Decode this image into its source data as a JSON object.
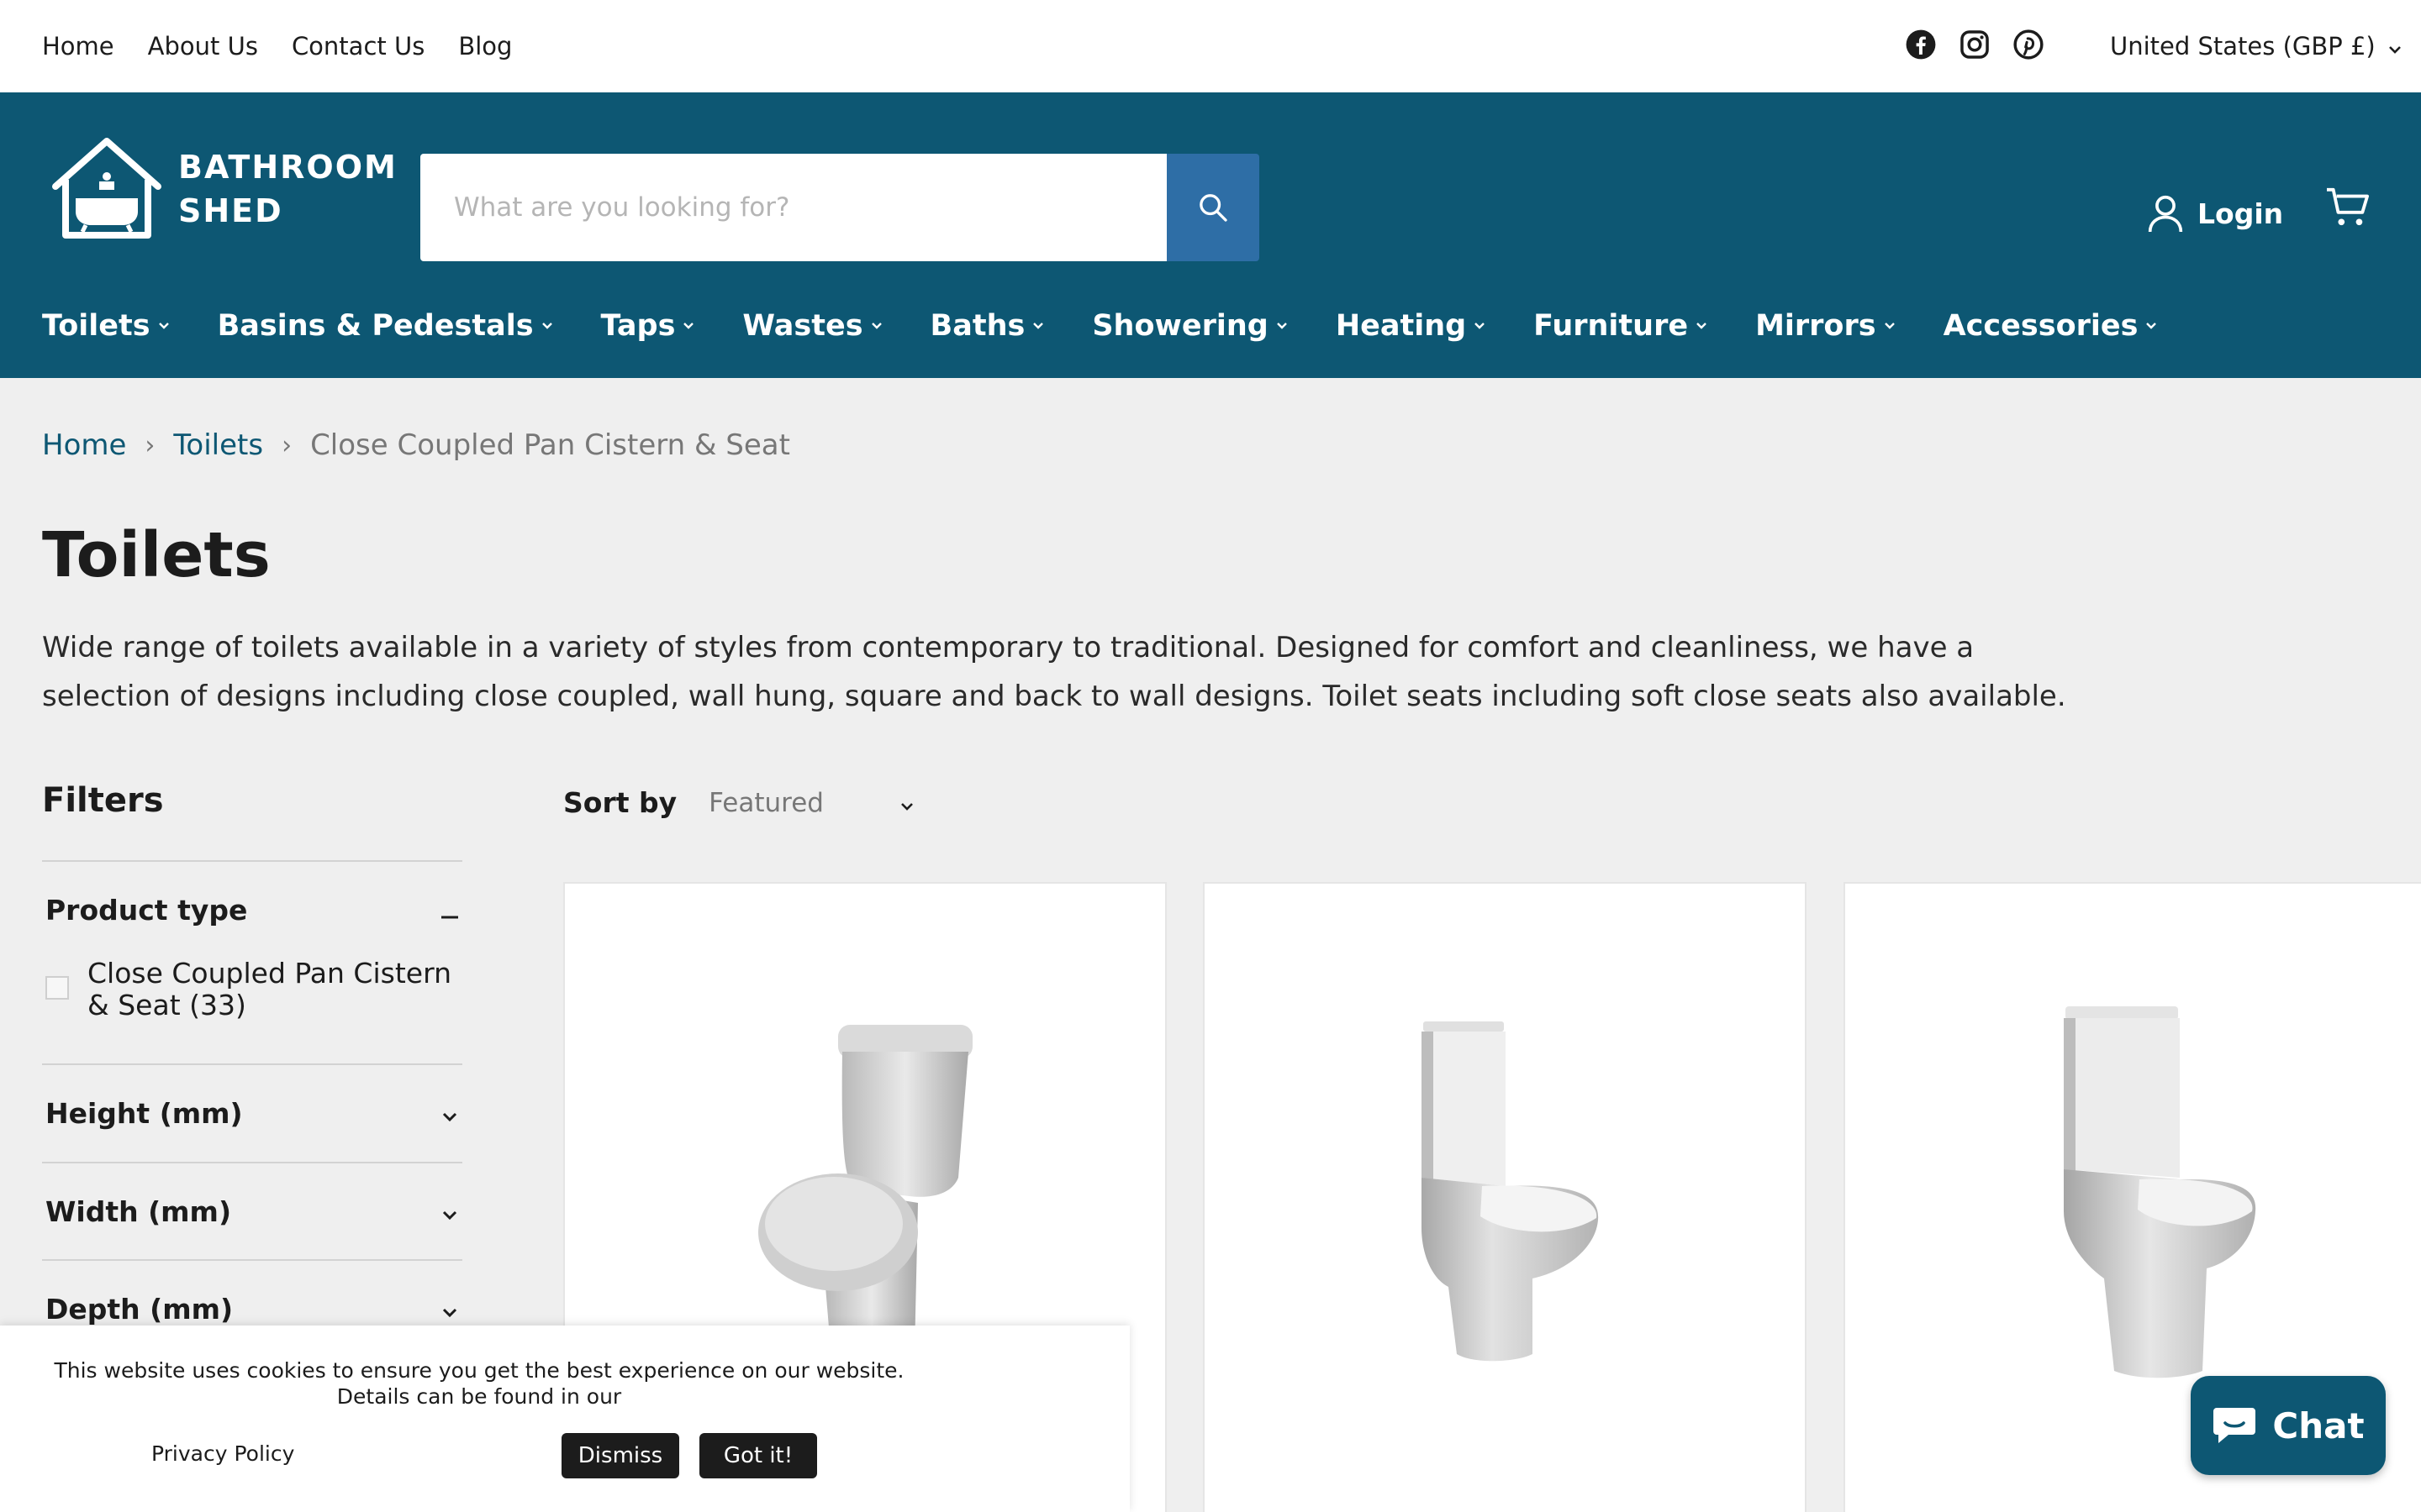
{
  "utility": {
    "links": [
      "Home",
      "About Us",
      "Contact Us",
      "Blog"
    ],
    "social_icons": [
      "facebook-icon",
      "instagram-icon",
      "pinterest-icon"
    ],
    "currency": "United States (GBP £)"
  },
  "header": {
    "logo_line1": "BATHROOM",
    "logo_line2": "SHED",
    "search_placeholder": "What are you looking for?",
    "login_label": "Login",
    "nav": [
      "Toilets",
      "Basins & Pedestals",
      "Taps",
      "Wastes",
      "Baths",
      "Showering",
      "Heating",
      "Furniture",
      "Mirrors",
      "Accessories"
    ]
  },
  "breadcrumb": {
    "home": "Home",
    "parent": "Toilets",
    "current": "Close Coupled Pan Cistern & Seat"
  },
  "page": {
    "title": "Toilets",
    "description": "Wide range of toilets available in a variety of styles from contemporary to traditional. Designed for comfort and cleanliness, we have a selection of designs including close coupled, wall hung, square and back to wall designs. Toilet seats including soft close seats also available."
  },
  "filters": {
    "title": "Filters",
    "product_type_label": "Product type",
    "product_type_option": "Close Coupled Pan Cistern & Seat (33)",
    "height_label": "Height (mm)",
    "width_label": "Width (mm)",
    "depth_label": "Depth (mm)"
  },
  "sort": {
    "label": "Sort by",
    "selected": "Featured"
  },
  "cookie": {
    "message": "This website uses cookies to ensure you get the best experience on our website. Details can be found in our",
    "policy_link": "Privacy Policy",
    "dismiss": "Dismiss",
    "accept": "Got it!"
  },
  "chat": {
    "label": "Chat"
  },
  "colors": {
    "header_bg": "#0d5773",
    "search_button": "#2e6ea6",
    "page_bg": "#efefef"
  }
}
